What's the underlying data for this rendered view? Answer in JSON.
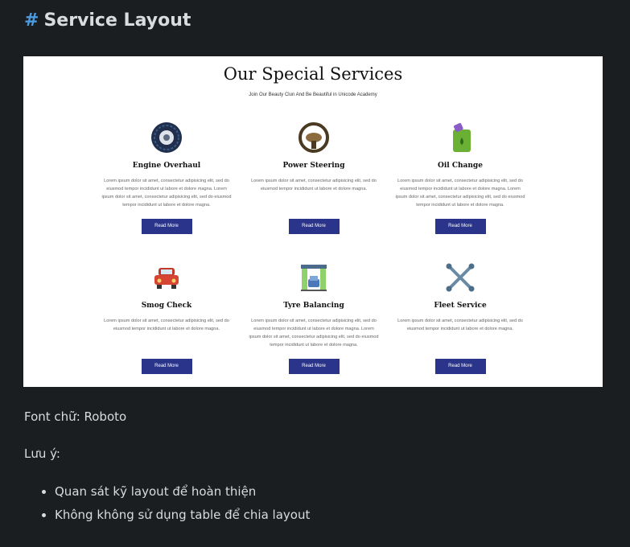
{
  "doc": {
    "hash": "#",
    "heading": "Service Layout",
    "font_note": "Font chữ: Roboto",
    "note_label": "Lưu ý:",
    "notes": [
      "Quan sát kỹ layout để hoàn thiện",
      "Không không sử dụng table để chia layout"
    ]
  },
  "preview": {
    "title": "Our Special Services",
    "subtitle": "Join Our Beauty Clun And Be Beautiful in Unicode Academy",
    "services": [
      {
        "icon": "tire-icon",
        "title": "Engine Overhaul",
        "desc": "Lorem ipsum dolor sit amet, consectetur adipisicing elit, sed do eiusmod tempor incididunt ut labore et dolore magna. Lorem ipsum dolor sit amet, consectetur adipisicing elit, sed do eiusmod tempor incididunt ut labore et dolore magna.",
        "button": "Read More"
      },
      {
        "icon": "steering-wheel-icon",
        "title": "Power Steering",
        "desc": "Lorem ipsum dolor sit amet, consectetur adipisicing elit, sed do eiusmod tempor incididunt ut labore et dolore magna.",
        "button": "Read More"
      },
      {
        "icon": "oil-can-icon",
        "title": "Oil Change",
        "desc": "Lorem ipsum dolor sit amet, consectetur adipisicing elit, sed do eiusmod tempor incididunt ut labore et dolore magna. Lorem ipsum dolor sit amet, consectetur adipisicing elit, sed do eiusmod tempor incididunt ut labore et dolore magna.",
        "button": "Read More"
      },
      {
        "icon": "car-icon",
        "title": "Smog Check",
        "desc": "Lorem ipsum dolor sit amet, consectetur adipisicing elit, sed do eiusmod tempor incididunt ut labore et dolore magna.",
        "button": "Read More"
      },
      {
        "icon": "car-wash-icon",
        "title": "Tyre Balancing",
        "desc": "Lorem ipsum dolor sit amet, consectetur adipisicing elit, sed do eiusmod tempor incididunt ut labore et dolore magna. Lorem ipsum dolor sit amet, consectetur adipisicing elit, sed do eiusmod tempor incididunt ut labore et dolore magna.",
        "button": "Read More"
      },
      {
        "icon": "wrench-icon",
        "title": "Fleet Service",
        "desc": "Lorem ipsum dolor sit amet, consectetur adipisicing elit, sed do eiusmod tempor incididunt ut labore et dolore magna.",
        "button": "Read More"
      }
    ]
  },
  "colors": {
    "background": "#1b1e21",
    "heading_text": "#d9dcdf",
    "hash_accent": "#4b9be0",
    "button": "#29348a"
  }
}
